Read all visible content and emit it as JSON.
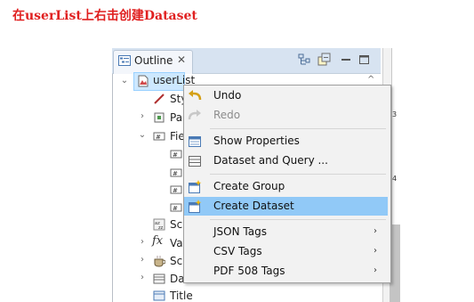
{
  "caption": "在userList上右击创建Dataset",
  "outline_view": {
    "tab_label": "Outline",
    "tab_close": "✕",
    "toolbar_icons": [
      "link-editor-icon",
      "collapse-all-icon",
      "minimize-icon",
      "maximize-icon"
    ],
    "ruler_numbers": [
      "3",
      "4"
    ],
    "root": {
      "label": "userList",
      "selected": true
    },
    "tree_items": [
      {
        "label": "Sty",
        "icon": "style-icon",
        "twisty": ""
      },
      {
        "label": "Pa",
        "icon": "parameter-icon",
        "twisty": "collapsed"
      },
      {
        "label": "Fie",
        "icon": "fields-icon",
        "twisty": "expanded"
      },
      {
        "label": "",
        "icon": "field-icon",
        "twisty": ""
      },
      {
        "label": "",
        "icon": "field-icon",
        "twisty": ""
      },
      {
        "label": "",
        "icon": "field-icon",
        "twisty": ""
      },
      {
        "label": "",
        "icon": "field-icon",
        "twisty": ""
      },
      {
        "label": "Sc",
        "icon": "sort-icon",
        "twisty": ""
      },
      {
        "label": "Va",
        "icon": "fx-icon",
        "twisty": "collapsed"
      },
      {
        "label": "Sc",
        "icon": "scriptlet-icon",
        "twisty": "collapsed"
      },
      {
        "label": "Da",
        "icon": "dataset-icon",
        "twisty": "collapsed"
      },
      {
        "label": "Title",
        "icon": "title-band-icon",
        "twisty": ""
      }
    ]
  },
  "context_menu": {
    "items": [
      {
        "label": "Undo",
        "icon": "undo-icon",
        "disabled": false
      },
      {
        "label": "Redo",
        "icon": "redo-icon",
        "disabled": true
      },
      {
        "label": "Show Properties",
        "icon": "properties-icon",
        "disabled": false
      },
      {
        "label": "Dataset and Query ...",
        "icon": "dataset-query-icon",
        "disabled": false
      },
      {
        "label": "Create Group",
        "icon": "create-group-icon",
        "disabled": false
      },
      {
        "label": "Create Dataset",
        "icon": "create-dataset-icon",
        "disabled": false,
        "highlighted": true
      },
      {
        "label": "JSON Tags",
        "icon": "",
        "submenu": true
      },
      {
        "label": "CSV Tags",
        "icon": "",
        "submenu": true
      },
      {
        "label": "PDF 508 Tags",
        "icon": "",
        "submenu": true
      }
    ]
  },
  "colors": {
    "caption": "#e02020",
    "menu_highlight": "#91c9f7",
    "selection": "#cde8ff",
    "tab_bar": "#d7e3f1"
  }
}
